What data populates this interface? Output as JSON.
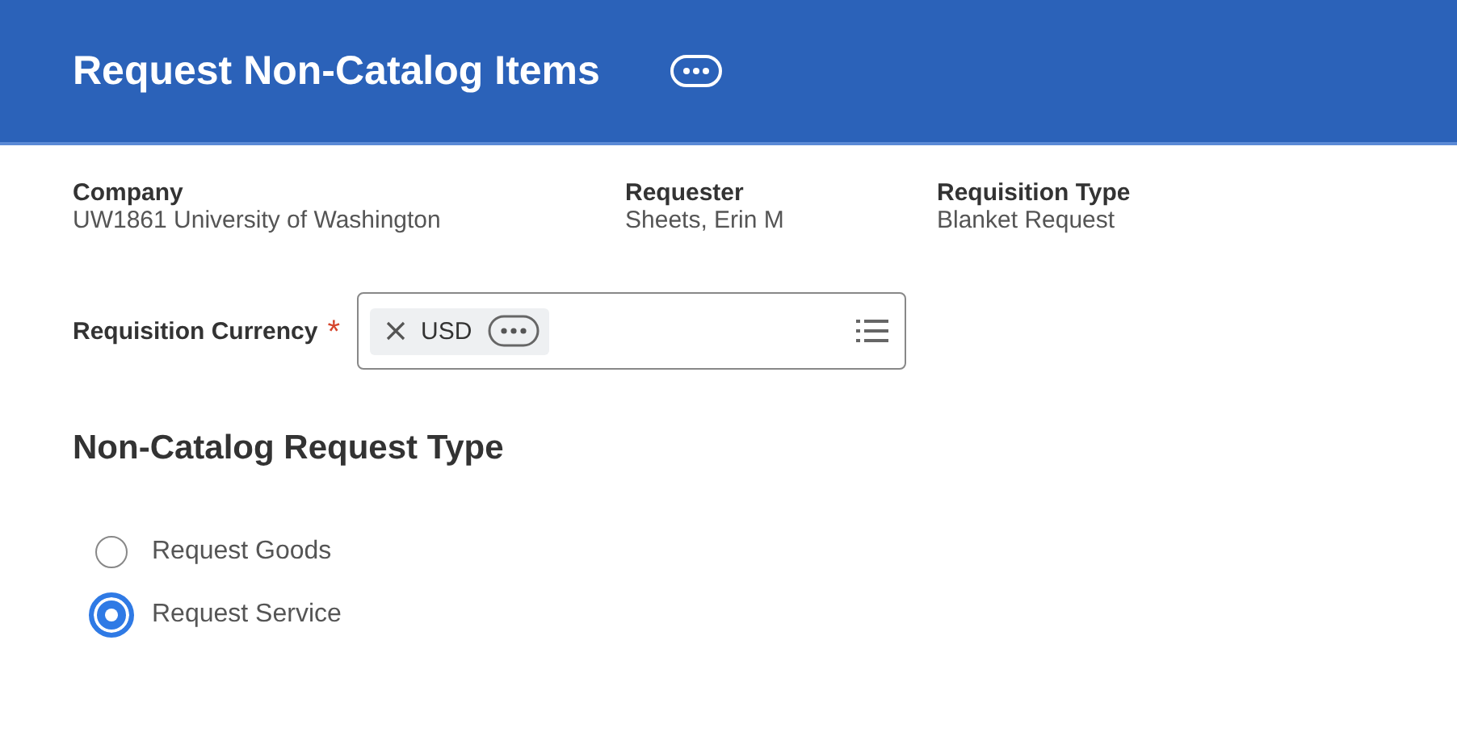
{
  "header": {
    "title": "Request Non-Catalog Items"
  },
  "info_fields": [
    {
      "label": "Company",
      "value": "UW1861 University of Washington"
    },
    {
      "label": "Requester",
      "value": "Sheets, Erin M"
    },
    {
      "label": "Requisition Type",
      "value": "Blanket Request"
    }
  ],
  "currency": {
    "label": "Requisition Currency",
    "required_mark": "*",
    "required": true,
    "selected_values": [
      {
        "label": "USD"
      }
    ]
  },
  "section": {
    "title": "Non-Catalog Request Type"
  },
  "options": [
    {
      "label": "Request Goods",
      "selected": false
    },
    {
      "label": "Request Service",
      "selected": true
    }
  ]
}
